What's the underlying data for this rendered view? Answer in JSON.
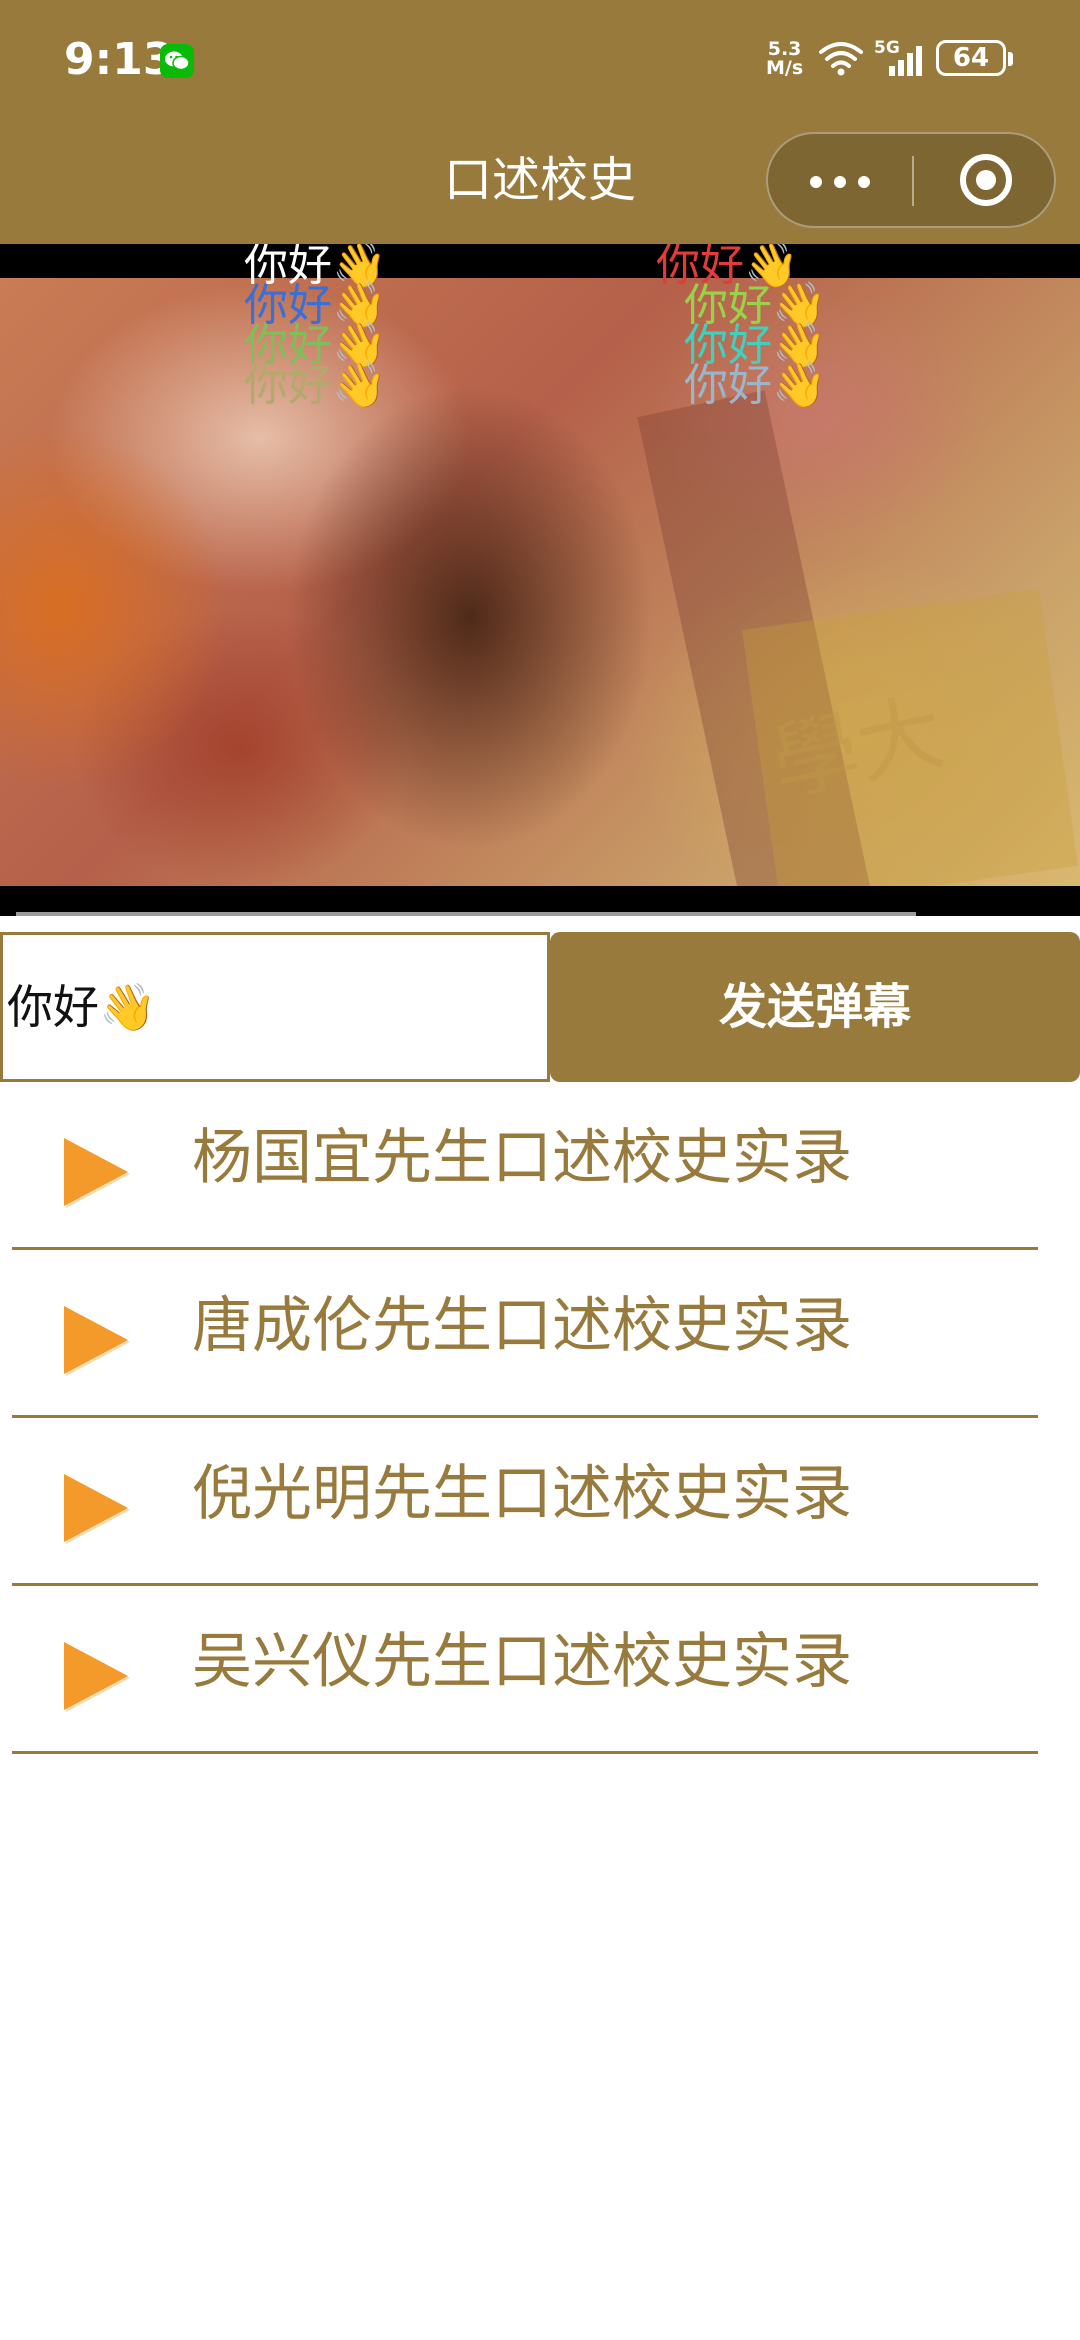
{
  "status_bar": {
    "time": "9:13",
    "net_speed_value": "5.3",
    "net_speed_unit": "M/s",
    "network": "5G",
    "battery": "64",
    "icons": [
      "wechat-icon",
      "wifi-icon",
      "signal-icon",
      "battery-icon"
    ]
  },
  "nav": {
    "title": "口述校史",
    "more_icon": "more-dots-icon",
    "close_icon": "target-close-icon"
  },
  "video": {
    "watermark": "學大",
    "danmaku": [
      {
        "text": "你好👋",
        "color": "#ffffff"
      },
      {
        "text": "你好👋",
        "color": "#3a6fd8"
      },
      {
        "text": "你好👋",
        "color": "#7fbf5a"
      },
      {
        "text": "你好👋",
        "color": "#b2aa6a"
      },
      {
        "text": "你好👋",
        "color": "#e23b3b"
      },
      {
        "text": "你好👋",
        "color": "#9ad14a"
      },
      {
        "text": "你好👋",
        "color": "#3fd0c0"
      },
      {
        "text": "你好👋",
        "color": "#9ab6c8"
      }
    ]
  },
  "composer": {
    "input_value": "你好👋",
    "send_label": "发送弹幕"
  },
  "list": {
    "items": [
      {
        "label": "杨国宜先生口述校史实录"
      },
      {
        "label": "唐成伦先生口述校史实录"
      },
      {
        "label": "倪光明先生口述校史实录"
      },
      {
        "label": "吴兴仪先生口述校史实录"
      }
    ]
  },
  "colors": {
    "brand": "#977a3c",
    "play_icon": "#f39a2a",
    "background": "#ffffff"
  }
}
